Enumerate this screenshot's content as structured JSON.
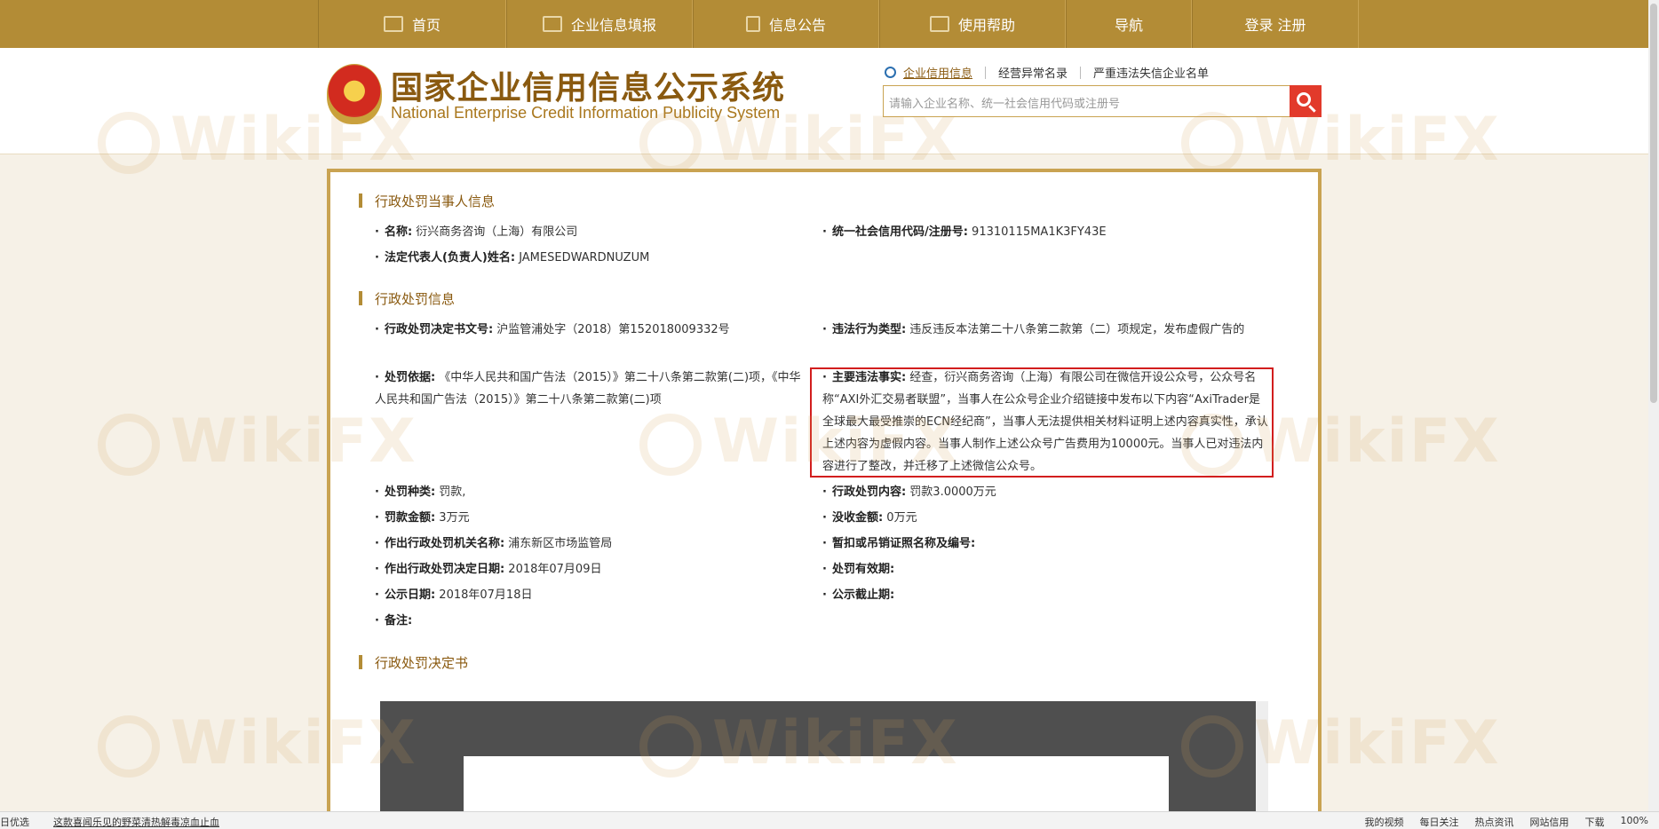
{
  "topnav": {
    "items": [
      {
        "label": "首页",
        "icon": "monitor-icon"
      },
      {
        "label": "企业信息填报",
        "icon": "edit-icon"
      },
      {
        "label": "信息公告",
        "icon": "document-icon"
      },
      {
        "label": "使用帮助",
        "icon": "speaker-icon"
      },
      {
        "label": "导航",
        "icon": ""
      },
      {
        "label": "登录  注册",
        "icon": ""
      }
    ]
  },
  "header": {
    "title_cn": "国家企业信用信息公示系统",
    "title_en": "National Enterprise Credit Information Publicity System",
    "search_tabs": [
      "企业信用信息",
      "经营异常名录",
      "严重违法失信企业名单"
    ],
    "search_placeholder": "请输入企业名称、统一社会信用代码或注册号"
  },
  "section1": {
    "title": "行政处罚当事人信息",
    "name_label": "名称:",
    "name_value": "衍兴商务咨询（上海）有限公司",
    "credit_label": "统一社会信用代码/注册号:",
    "credit_value": "91310115MA1K3FY43E",
    "rep_label": "法定代表人(负责人)姓名:",
    "rep_value": "JAMESEDWARDNUZUM"
  },
  "section2": {
    "title": "行政处罚信息",
    "docno_label": "行政处罚决定书文号:",
    "docno_value": "沪监管浦处字（2018）第152018009332号",
    "type_label": "违法行为类型:",
    "type_value": "违反违反本法第二十八条第二款第（二）项规定，发布虚假广告的",
    "basis_label": "处罚依据:",
    "basis_value": "《中华人民共和国广告法（2015）》第二十八条第二款第(二)项，《中华人民共和国广告法（2015）》第二十八条第二款第(二)项",
    "facts_label": "主要违法事实:",
    "facts_value": "经查，衍兴商务咨询（上海）有限公司在微信开设公众号，公众号名称“AXI外汇交易者联盟”，当事人在公众号企业介绍链接中发布以下内容“AxiTrader是全球最大最受推崇的ECN经纪商”，当事人无法提供相关材料证明上述内容真实性，承认上述内容为虚假内容。当事人制作上述公众号广告费用为10000元。当事人已对违法内容进行了整改，并迁移了上述微信公众号。",
    "kind_label": "处罚种类:",
    "kind_value": "罚款,",
    "content_label": "行政处罚内容:",
    "content_value": "罚款3.0000万元",
    "fine_label": "罚款金额:",
    "fine_value": "3万元",
    "confiscate_label": "没收金额:",
    "confiscate_value": "0万元",
    "org_label": "作出行政处罚机关名称:",
    "org_value": "浦东新区市场监管局",
    "license_label": "暂扣或吊销证照名称及编号:",
    "license_value": "",
    "date_label": "作出行政处罚决定日期:",
    "date_value": "2018年07月09日",
    "validity_label": "处罚有效期:",
    "validity_value": "",
    "pub_label": "公示日期:",
    "pub_value": "2018年07月18日",
    "pubend_label": "公示截止期:",
    "pubend_value": "",
    "note_label": "备注:",
    "note_value": ""
  },
  "section3": {
    "title": "行政处罚决定书"
  },
  "watermark": {
    "text": "WikiFX"
  },
  "statusbar": {
    "left": "日优选",
    "news": "这款喜闻乐见的野菜清热解毒凉血止血",
    "items": [
      "我的视频",
      "每日关注",
      "热点资讯",
      "网站信用",
      "下载",
      "100%"
    ]
  }
}
